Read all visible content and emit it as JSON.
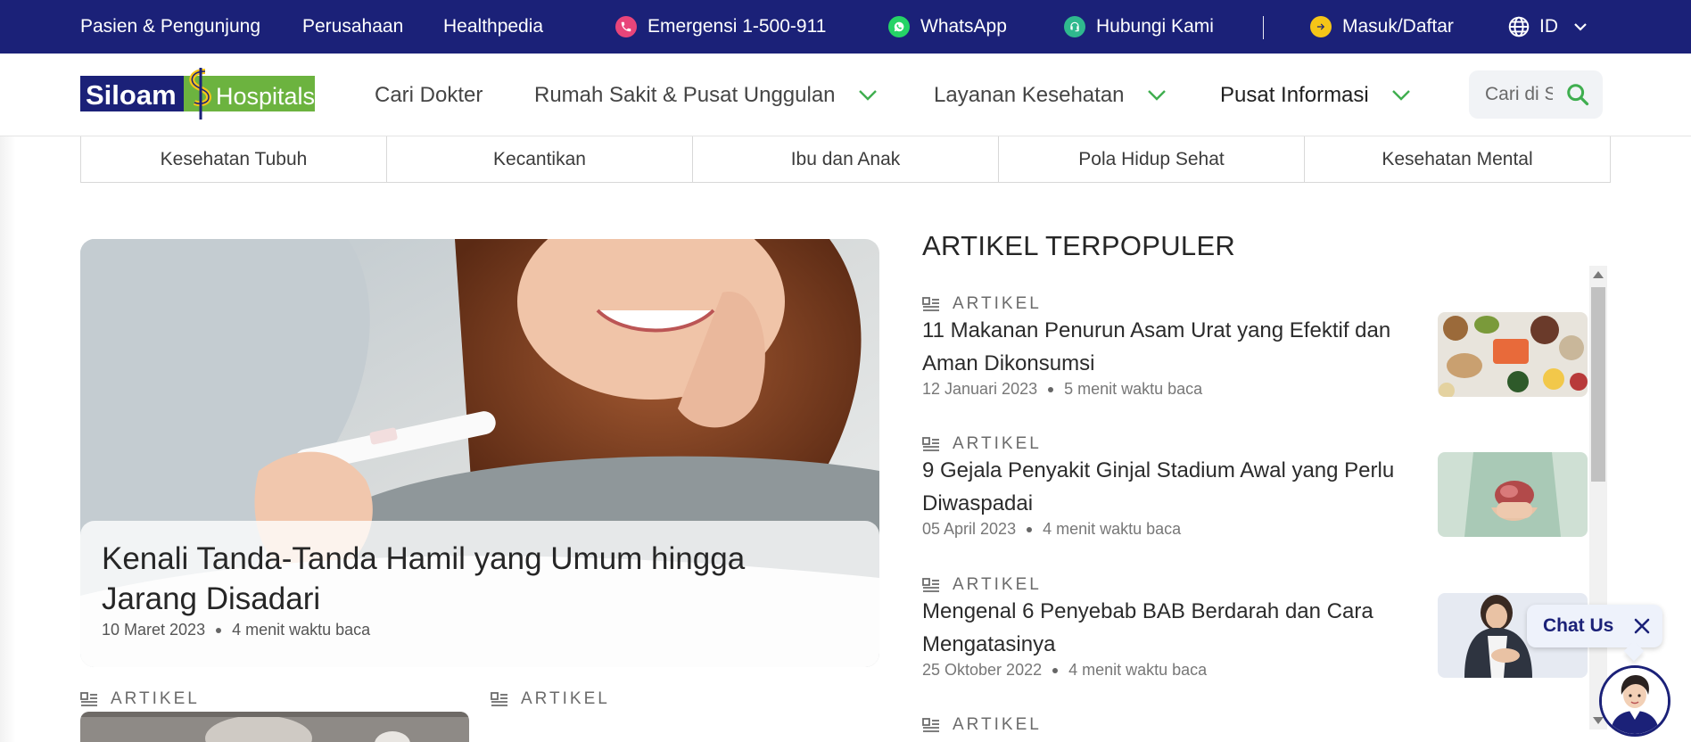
{
  "topbar": {
    "links": [
      "Pasien & Pengunjung",
      "Perusahaan",
      "Healthpedia"
    ],
    "emergency": {
      "label": "Emergensi 1-500-911",
      "icon": "phone-icon",
      "color": "#e8457a"
    },
    "whatsapp": {
      "label": "WhatsApp",
      "icon": "whatsapp-icon",
      "color": "#25d366"
    },
    "contact": {
      "label": "Hubungi Kami",
      "icon": "headset-icon",
      "color": "#2fb98e"
    },
    "login": {
      "label": "Masuk/Daftar",
      "icon": "arrow-right-icon",
      "color": "#f5c518"
    },
    "language": {
      "label": "ID",
      "icon": "globe-icon"
    },
    "background": "#1b2178"
  },
  "logo": {
    "text_a": "Siloam",
    "text_b": "Hospitals",
    "brand_blue": "#1b2178",
    "brand_green": "#6cb33f",
    "brand_yellow": "#f5c518"
  },
  "nav": {
    "items": [
      "Cari Dokter",
      "Rumah Sakit & Pusat Unggulan",
      "Layanan Kesehatan",
      "Pusat Informasi"
    ],
    "search_placeholder": "Cari di Siloam",
    "chevron_color": "#3fae4f"
  },
  "categories": [
    "Kesehatan Tubuh",
    "Kecantikan",
    "Ibu dan Anak",
    "Pola Hidup Sehat",
    "Kesehatan Mental"
  ],
  "hero": {
    "title": "Kenali Tanda-Tanda Hamil yang Umum hingga Jarang Disadari",
    "date": "10 Maret 2023",
    "read_time": "4 menit waktu baca"
  },
  "lower": {
    "label_left": "ARTIKEL",
    "label_right": "ARTIKEL"
  },
  "popular": {
    "heading": "ARTIKEL TERPOPULER",
    "items": [
      {
        "label": "ARTIKEL",
        "title": "11 Makanan Penurun Asam Urat yang Efektif dan Aman Dikonsumsi",
        "date": "12 Januari 2023",
        "read_time": "5 menit waktu baca"
      },
      {
        "label": "ARTIKEL",
        "title": "9 Gejala Penyakit Ginjal Stadium Awal yang Perlu Diwaspadai",
        "date": "05 April 2023",
        "read_time": "4 menit waktu baca"
      },
      {
        "label": "ARTIKEL",
        "title": "Mengenal 6 Penyebab BAB Berdarah dan Cara Mengatasinya",
        "date": "25 Oktober 2022",
        "read_time": "4 menit waktu baca"
      },
      {
        "label": "ARTIKEL"
      }
    ]
  },
  "chat": {
    "label": "Chat Us"
  }
}
